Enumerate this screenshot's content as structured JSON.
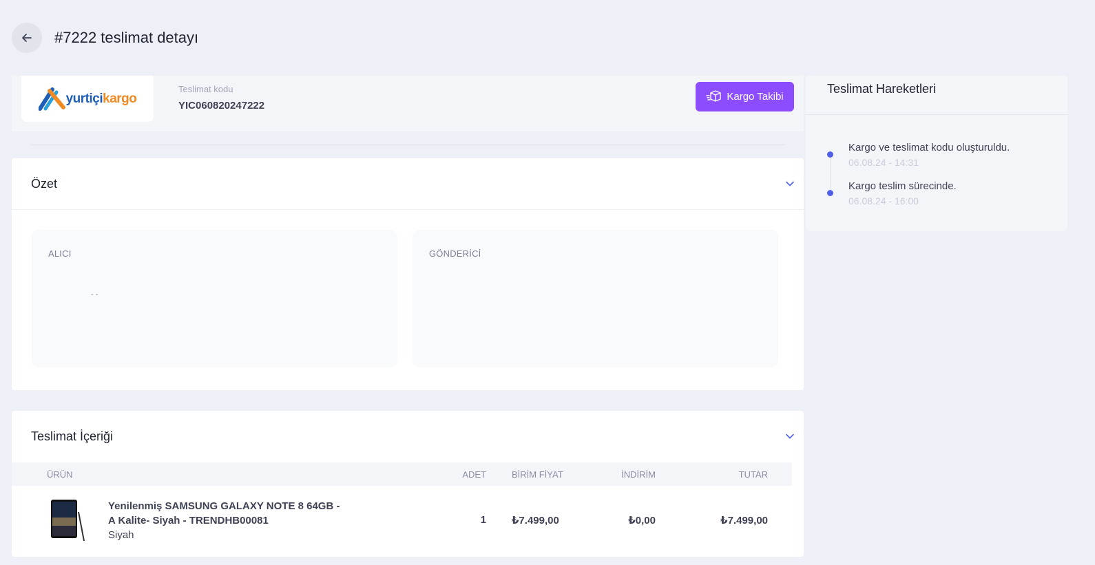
{
  "header": {
    "title": "#7222 teslimat detayı",
    "back_icon": "arrow-left-icon"
  },
  "carrier": {
    "logo_text_yurtici": "yurtiçi",
    "logo_text_kargo": "kargo",
    "code_label": "Teslimat kodu",
    "code_value": "YIC060820247222",
    "track_button": "Kargo Takibi"
  },
  "summary": {
    "title": "Özet",
    "receiver_label": "ALICI",
    "receiver_value": "- -",
    "sender_label": "GÖNDERİCİ"
  },
  "contents": {
    "title": "Teslimat İçeriği",
    "columns": {
      "product": "ÜRÜN",
      "qty": "ADET",
      "unit_price": "BİRİM FİYAT",
      "discount": "İNDİRİM",
      "total": "TUTAR"
    },
    "rows": [
      {
        "name": "Yenilenmiş SAMSUNG GALAXY NOTE 8 64GB - A Kalite- Siyah - TRENDHB00081",
        "variant": "Siyah",
        "qty": "1",
        "unit_price": "₺7.499,00",
        "discount": "₺0,00",
        "total": "₺7.499,00"
      }
    ]
  },
  "movements": {
    "title": "Teslimat Hareketleri",
    "events": [
      {
        "text": "Kargo ve teslimat kodu oluşturuldu.",
        "time": "06.08.24 - 14:31"
      },
      {
        "text": "Kargo teslim sürecinde.",
        "time": "06.08.24 - 16:00"
      }
    ]
  },
  "colors": {
    "accent": "#8b4dff",
    "timeline": "#4f5fe8",
    "background": "#eef0f7"
  }
}
